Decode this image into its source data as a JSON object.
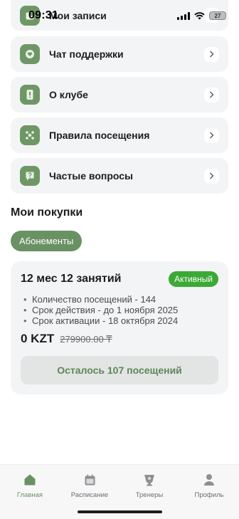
{
  "status_bar": {
    "time": "09:31",
    "battery": "27"
  },
  "menu": {
    "items": [
      {
        "label": "Мои записи",
        "icon": "calendar-check-icon"
      },
      {
        "label": "Чат поддержки",
        "icon": "heart-icon"
      },
      {
        "label": "О клубе",
        "icon": "info-icon"
      },
      {
        "label": "Правила посещения",
        "icon": "rules-icon"
      },
      {
        "label": "Частые вопросы",
        "icon": "question-icon"
      }
    ]
  },
  "purchases": {
    "title": "Мои покупки",
    "filter_chip": "Абонементы"
  },
  "subscription": {
    "title": "12 мес 12 занятий",
    "status": "Активный",
    "details": [
      "Количество посещений - 144",
      "Срок действия - до 1 ноября 2025",
      "Срок активации - 18 октября 2024"
    ],
    "price": "0 KZT",
    "old_price": "279900.00 ₸",
    "remaining": "Осталось 107 посещений"
  },
  "tab_bar": {
    "tabs": [
      {
        "label": "Главная",
        "icon": "home-icon",
        "active": true
      },
      {
        "label": "Расписание",
        "icon": "calendar-icon",
        "active": false
      },
      {
        "label": "Тренеры",
        "icon": "trainer-icon",
        "active": false
      },
      {
        "label": "Профиль",
        "icon": "profile-icon",
        "active": false
      }
    ]
  },
  "colors": {
    "accent": "#6a9163",
    "active_badge": "#3aaa35",
    "card_bg": "#f3f4f5"
  }
}
